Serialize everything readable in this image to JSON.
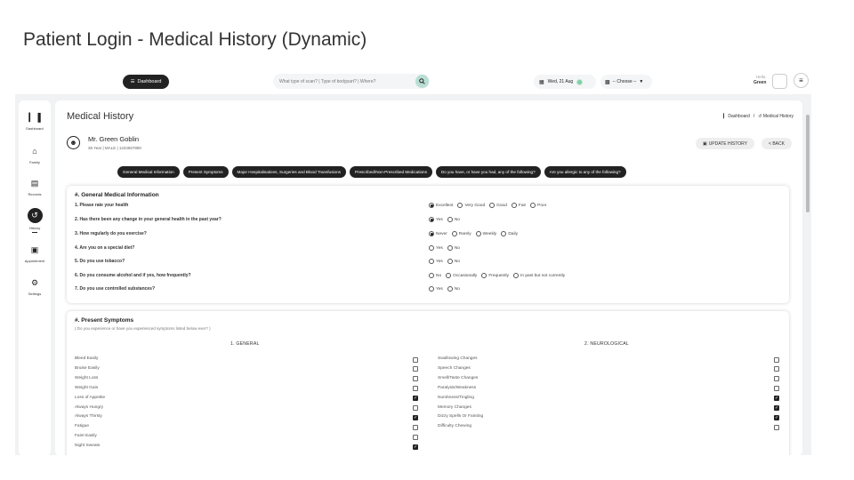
{
  "slide": {
    "title": "Patient Login - Medical History (Dynamic)"
  },
  "topbar": {
    "dashboard_label": "Dashboard",
    "search_placeholder": "What type of scan? | Type of bodypart? | Where?",
    "date": "Wed, 21 Aug",
    "choose": "-- Choose --",
    "hello": "Hello,",
    "user": "Green"
  },
  "sidebar": {
    "items": [
      {
        "label": "Dashboard",
        "icon": "bar-chart-icon"
      },
      {
        "label": "Family",
        "icon": "family-icon"
      },
      {
        "label": "Records",
        "icon": "records-icon"
      },
      {
        "label": "History",
        "icon": "history-icon",
        "active": true
      },
      {
        "label": "Appointment",
        "icon": "calendar-icon"
      },
      {
        "label": "Settings",
        "icon": "gear-icon"
      }
    ]
  },
  "page": {
    "title": "Medical History",
    "breadcrumb": {
      "home": "Dashboard",
      "separator": "/",
      "current": "Medical History"
    }
  },
  "patient": {
    "name": "Mr. Green Goblin",
    "meta": "36 Year | MALE | 1234567890"
  },
  "actions": {
    "update": "UPDATE HISTORY",
    "back": "< BACK"
  },
  "tabs": [
    "General Medical Information",
    "Present Symptoms",
    "Major Hospitalisations, Surgeries and Blood Transfusions",
    "Prescribed/Non-Prescribed Medications",
    "Do you have, or have you had, any of the following?",
    "Are you allergic to any of the following?"
  ],
  "general": {
    "title": "#. General Medical Information",
    "questions": [
      {
        "q": "1.  Please rate your health",
        "options": [
          "Excellent",
          "Very Good",
          "Good",
          "Fair",
          "Poor"
        ],
        "selected": 0
      },
      {
        "q": "2.  Has there been any change in your general health in the past year?",
        "options": [
          "Yes",
          "No"
        ],
        "selected": 0
      },
      {
        "q": "3.  How regularly do you exercise?",
        "options": [
          "Never",
          "Rarely",
          "Weekly",
          "Daily"
        ],
        "selected": 0
      },
      {
        "q": "4.  Are you on a special diet?",
        "options": [
          "Yes",
          "No"
        ],
        "selected": -1
      },
      {
        "q": "5.  Do you use tobacco?",
        "options": [
          "Yes",
          "No"
        ],
        "selected": -1
      },
      {
        "q": "6.  Do you consume alcohol and if yes, how frequently?",
        "options": [
          "No",
          "Occasionally",
          "Frequently",
          "In past but not currently"
        ],
        "selected": -1
      },
      {
        "q": "7.  Do you use controlled substances?",
        "options": [
          "Yes",
          "No"
        ],
        "selected": -1
      }
    ]
  },
  "symptoms": {
    "title": "#. Present Symptoms",
    "subtitle": "( Do you experience or have you experienced symptoms listed below ever? )",
    "general_head": "1.  GENERAL",
    "neuro_head": "2.  NEUROLOGICAL",
    "general": [
      {
        "label": "Bleed Easily",
        "checked": false
      },
      {
        "label": "Bruise Easily",
        "checked": false
      },
      {
        "label": "Weight Loss",
        "checked": false
      },
      {
        "label": "Weight Gain",
        "checked": false
      },
      {
        "label": "Loss of Appetite",
        "checked": true
      },
      {
        "label": "Always Hungry",
        "checked": false
      },
      {
        "label": "Always Thirsty",
        "checked": true
      },
      {
        "label": "Fatigue",
        "checked": false
      },
      {
        "label": "Faint Easily",
        "checked": false
      },
      {
        "label": "Night Sweats",
        "checked": true
      }
    ],
    "neuro": [
      {
        "label": "Swallowing Changes",
        "checked": false
      },
      {
        "label": "Speech Changes",
        "checked": false
      },
      {
        "label": "Smell/Taste Changes",
        "checked": false
      },
      {
        "label": "Paralysis/Weakness",
        "checked": false
      },
      {
        "label": "Numbness/Tingling",
        "checked": true
      },
      {
        "label": "Memory Changes",
        "checked": true
      },
      {
        "label": "Dizzy Spells Or Fainting",
        "checked": true
      },
      {
        "label": "Difficulty Chewing",
        "checked": false
      }
    ]
  },
  "colors": {
    "dark": "#222222",
    "accent": "#b9ded3",
    "date_dot": "#7fcfa8",
    "background": "#f1f2f4"
  }
}
